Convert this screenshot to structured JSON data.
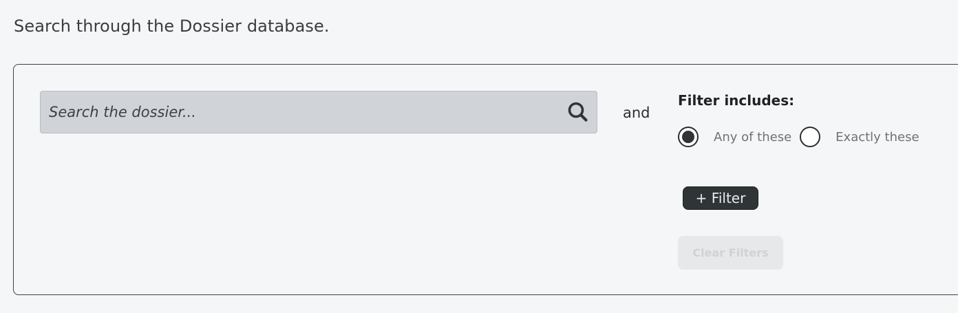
{
  "page": {
    "intro": "Search through the Dossier database."
  },
  "search": {
    "placeholder": "Search the dossier...",
    "value": "",
    "icon": "search-icon"
  },
  "connector": "and",
  "filter": {
    "heading": "Filter includes:",
    "options": [
      {
        "label": "Any of these",
        "checked": true
      },
      {
        "label": "Exactly these",
        "checked": false
      }
    ],
    "add_label": "+ Filter",
    "clear_label": "Clear Filters",
    "clear_disabled": true
  },
  "colors": {
    "background": "#f5f6f8",
    "search_bg": "#d0d4d9",
    "button_dark": "#2f3437",
    "disabled_bg": "#e6e8ea"
  }
}
